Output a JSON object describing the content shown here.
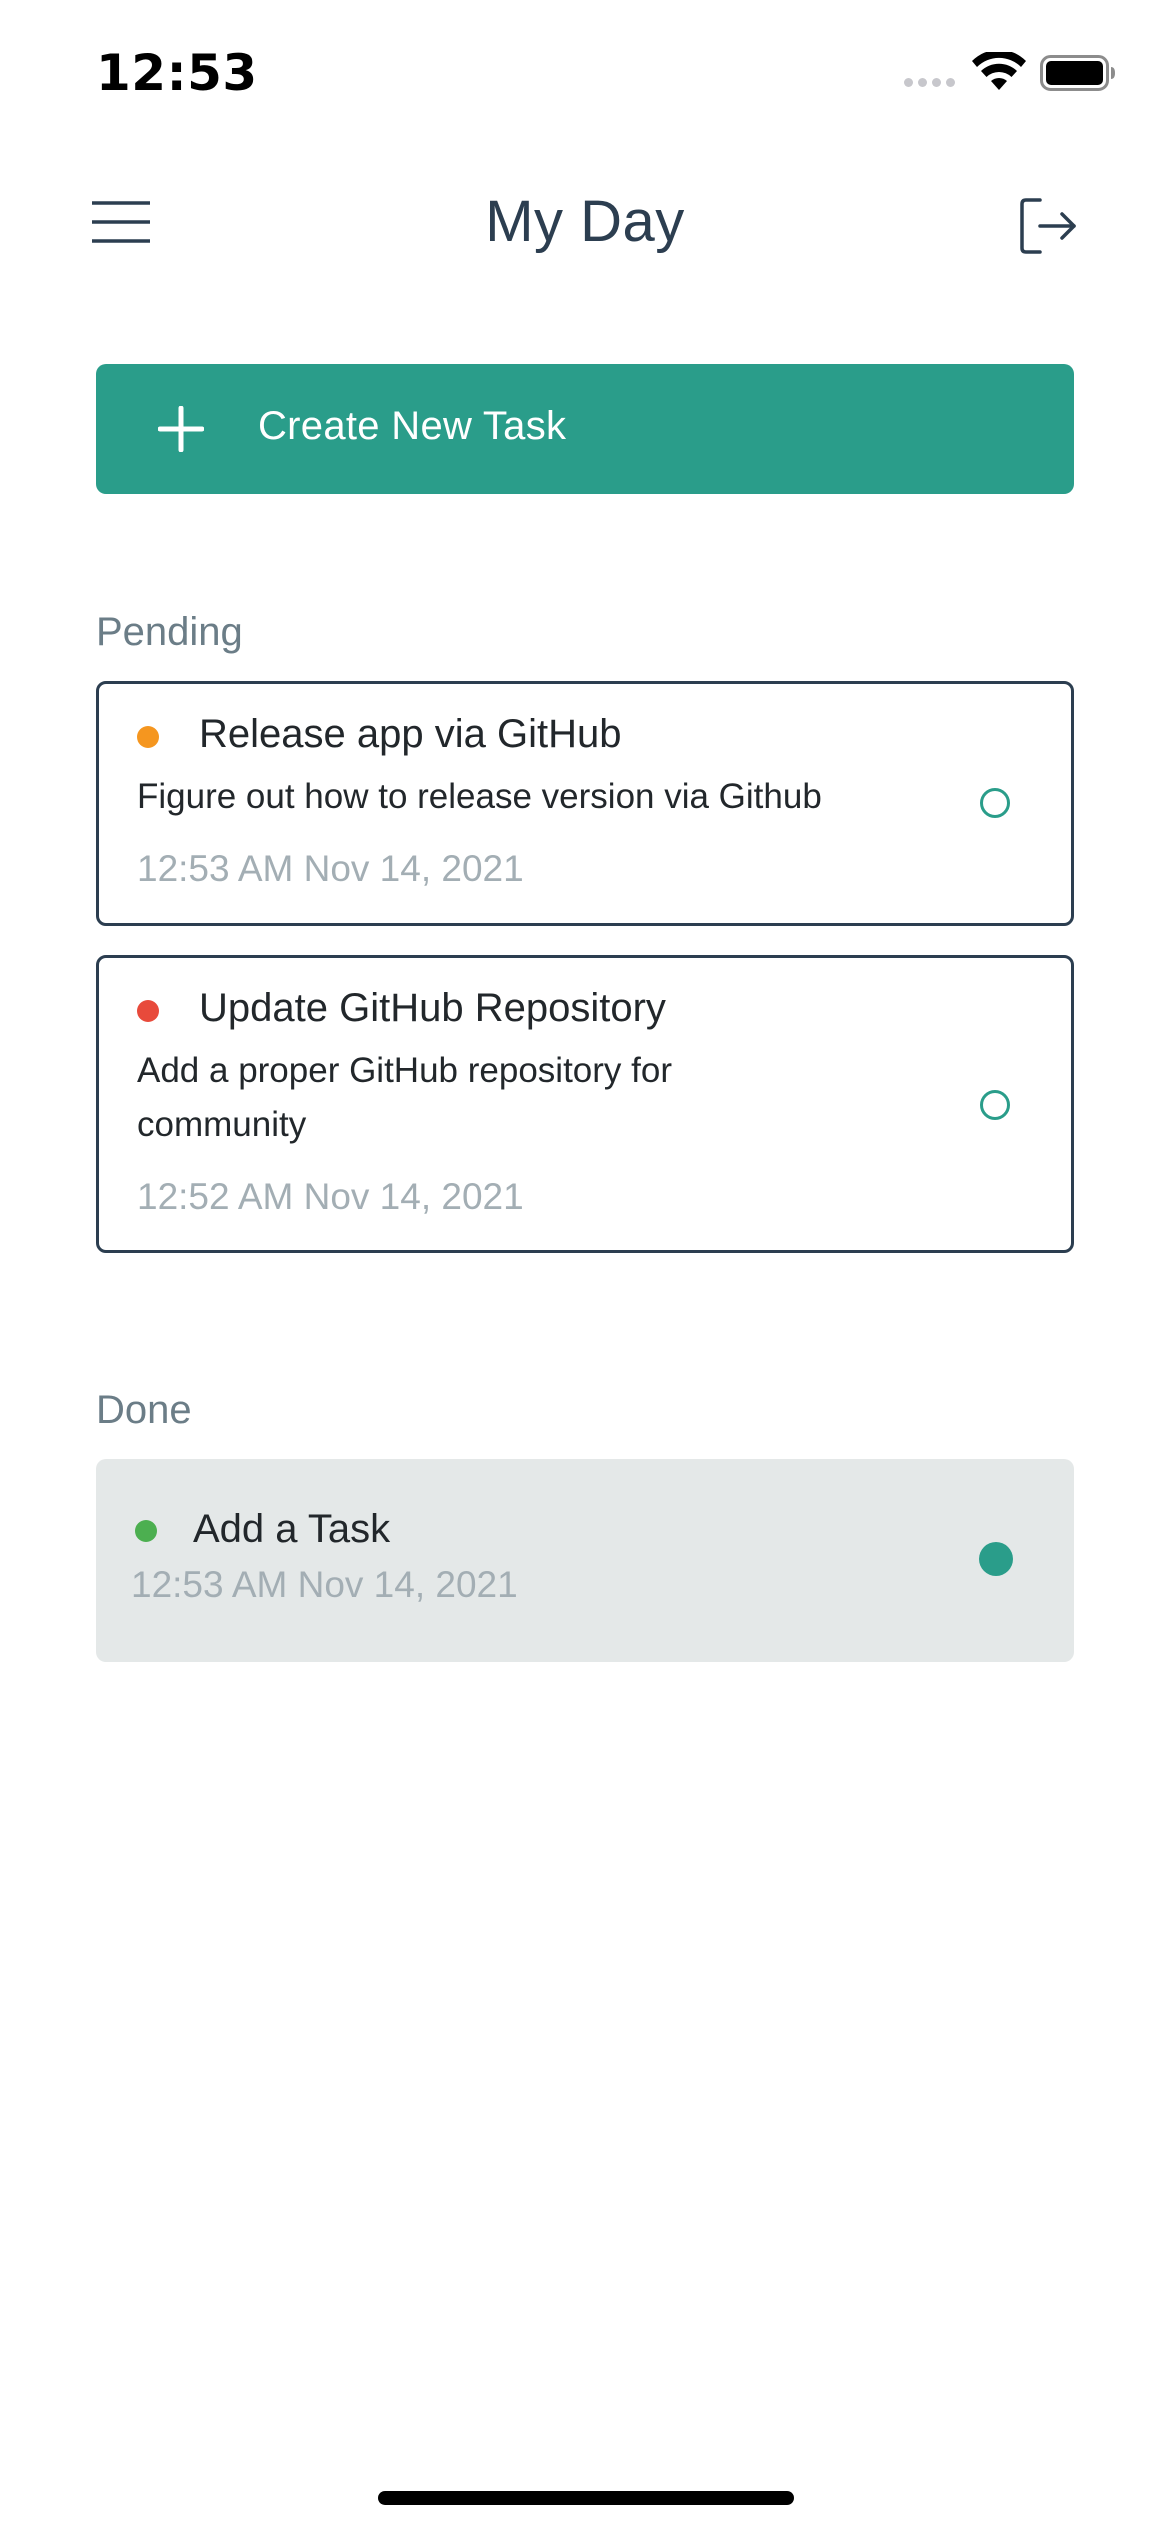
{
  "status_bar": {
    "time": "12:53"
  },
  "header": {
    "title": "My Day",
    "menu_icon": "hamburger-menu-icon",
    "logout_icon": "logout-icon"
  },
  "create_button": {
    "label": "Create New Task",
    "icon": "plus-icon"
  },
  "colors": {
    "accent": "#2a9d8a",
    "title": "#2c3e50",
    "section_heading": "#6b7d87",
    "timestamp": "#a3aeb4",
    "done_card_bg": "#e4e8e8",
    "priority_medium": "#f5961f",
    "priority_high": "#e84a3b",
    "priority_low": "#4caf50"
  },
  "pending": {
    "heading": "Pending",
    "tasks": [
      {
        "title": "Release app via GitHub",
        "description": "Figure out how to release version via Github",
        "timestamp": "12:53 AM Nov 14, 2021",
        "priority_color": "#f5961f",
        "done": false
      },
      {
        "title": "Update GitHub Repository",
        "description": "Add a proper GitHub repository for community",
        "timestamp": "12:52 AM Nov 14, 2021",
        "priority_color": "#e84a3b",
        "done": false
      }
    ]
  },
  "done": {
    "heading": "Done",
    "tasks": [
      {
        "title": "Add a Task",
        "timestamp": "12:53 AM Nov 14, 2021",
        "priority_color": "#4caf50",
        "done": true
      }
    ]
  }
}
